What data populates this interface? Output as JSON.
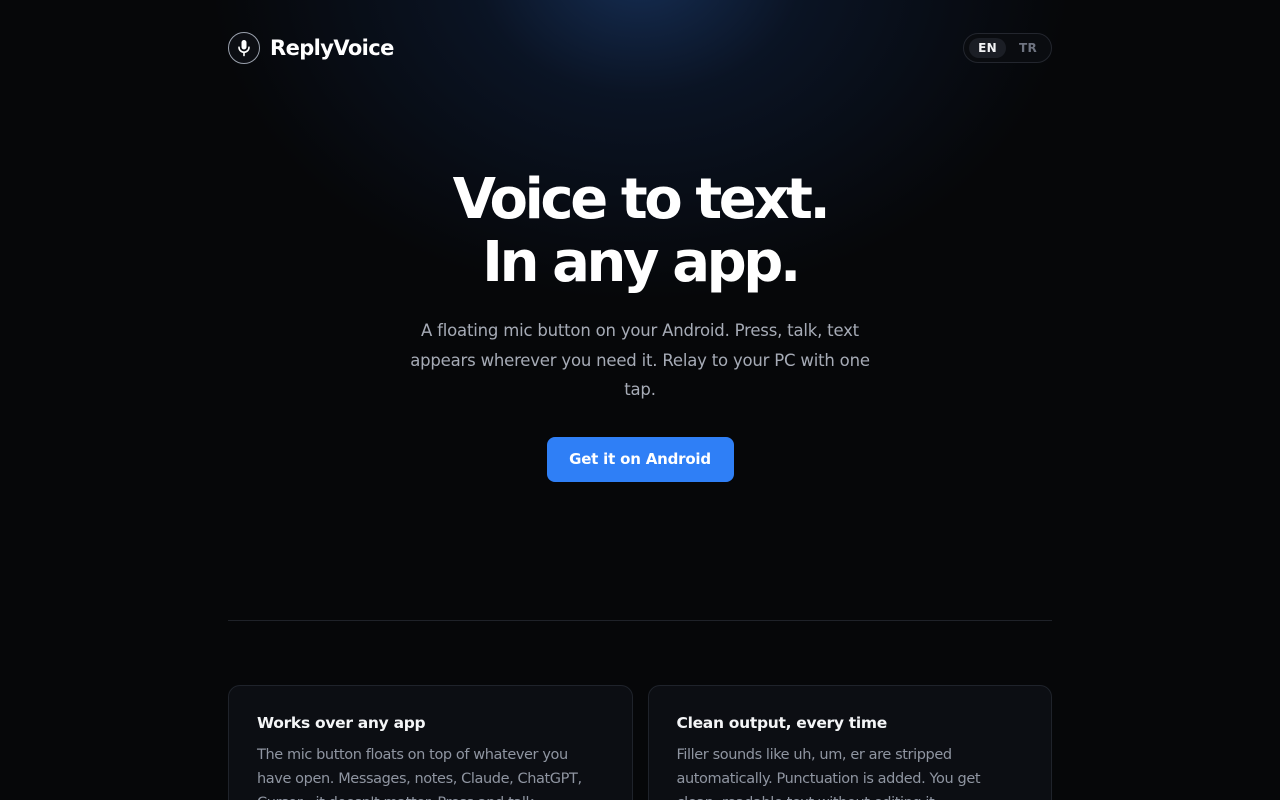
{
  "header": {
    "brand_name": "ReplyVoice",
    "brand_icon": "microphone-icon",
    "languages": [
      {
        "code": "EN",
        "active": true
      },
      {
        "code": "TR",
        "active": false
      }
    ]
  },
  "hero": {
    "title_line1": "Voice to text.",
    "title_line2": "In any app.",
    "subtitle": "A floating mic button on your Android. Press, talk, text appears wherever you need it. Relay to your PC with one tap.",
    "cta_label": "Get it on Android"
  },
  "features": [
    {
      "title": "Works over any app",
      "text": "The mic button floats on top of whatever you have open. Messages, notes, Claude, ChatGPT, Cursor - it doesn't matter. Press and talk."
    },
    {
      "title": "Clean output, every time",
      "text": "Filler sounds like uh, um, er are stripped automatically. Punctuation is added. You get clean, readable text without editing it."
    }
  ],
  "colors": {
    "accent": "#2f7ff6",
    "background": "#060709",
    "card_background": "#0c0e13"
  }
}
